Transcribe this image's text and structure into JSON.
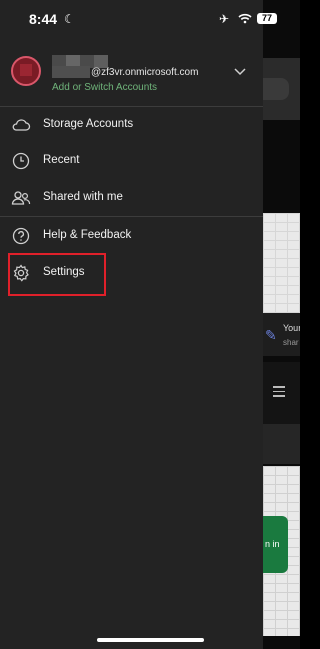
{
  "status_bar": {
    "time": "8:44",
    "battery": "77",
    "icons": [
      "moon-icon",
      "airplane-icon",
      "wifi-icon",
      "battery-icon"
    ]
  },
  "account": {
    "email_suffix": "@zf3vr.onmicrosoft.com",
    "switch_label": "Add or Switch Accounts"
  },
  "menu": {
    "items": [
      {
        "label": "Storage Accounts",
        "icon": "cloud-icon"
      },
      {
        "label": "Recent",
        "icon": "clock-icon"
      },
      {
        "label": "Shared with me",
        "icon": "people-icon"
      },
      {
        "label": "Help & Feedback",
        "icon": "help-icon"
      },
      {
        "label": "Settings",
        "icon": "gear-icon"
      }
    ]
  },
  "background_app": {
    "snippet_1": "Your",
    "snippet_2": "shar",
    "button_fragment": "n in"
  },
  "colors": {
    "drawer_bg": "#232323",
    "accent_green": "#6fb37a",
    "highlight_red": "#e0202a"
  }
}
